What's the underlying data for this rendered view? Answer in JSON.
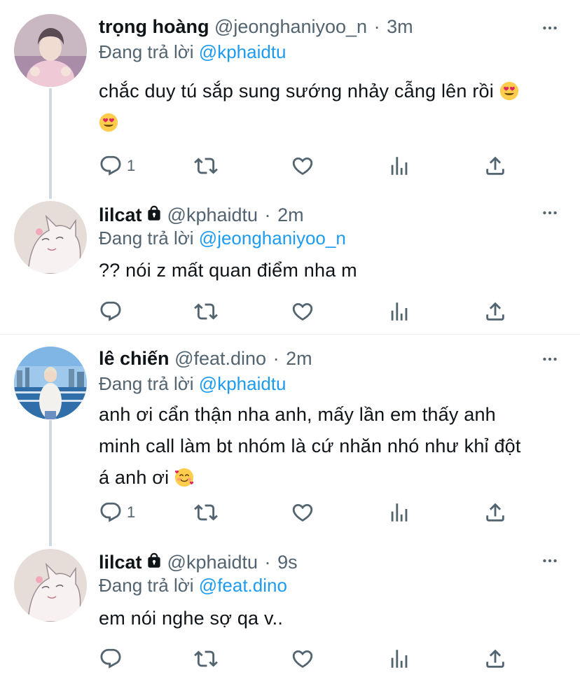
{
  "colors": {
    "text": "#0f1419",
    "secondary": "#536471",
    "accent": "#1d9bf0",
    "thread_line": "#cfd9de"
  },
  "replying_prefix": "Đang trả lời",
  "tweets": [
    {
      "name": "trọng hoàng",
      "handle": "@jeonghaniyoo_n",
      "dot": "·",
      "time": "3m",
      "replying_to": "@kphaidtu",
      "content_line1": "chắc duy tú sắp sung sướng nhảy cẫng lên rồi",
      "reply_count": "1",
      "emoji": "smiling-face-with-heart-eyes"
    },
    {
      "name": "lilcat",
      "handle": "@kphaidtu",
      "dot": "·",
      "time": "2m",
      "replying_to": "@jeonghaniyoo_n",
      "content": "?? nói z mất quan điểm nha m",
      "reply_count": "",
      "locked": true
    },
    {
      "name": "lê chiến",
      "handle": "@feat.dino",
      "dot": "·",
      "time": "2m",
      "replying_to": "@kphaidtu",
      "content_line1": "anh ơi cẩn thận nha anh, mấy lần em thấy anh",
      "content_line2": "minh call làm bt nhóm là cứ nhăn nhó như khỉ đột",
      "content_line3": "á anh ơi",
      "reply_count": "1",
      "emoji": "smiling-face-with-hearts"
    },
    {
      "name": "lilcat",
      "handle": "@kphaidtu",
      "dot": "·",
      "time": "9s",
      "replying_to": "@feat.dino",
      "content": "em nói nghe sợ qa v..",
      "reply_count": "",
      "locked": true
    }
  ]
}
